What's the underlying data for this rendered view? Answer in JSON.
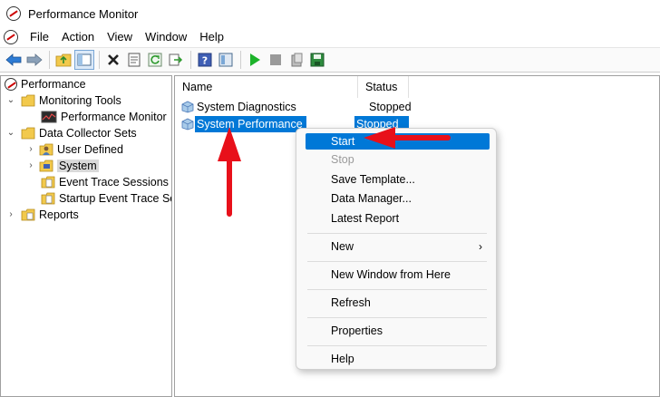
{
  "window": {
    "title": "Performance Monitor"
  },
  "menu": {
    "items": [
      "File",
      "Action",
      "View",
      "Window",
      "Help"
    ]
  },
  "toolbar": {
    "icons": [
      "back-arrow-icon",
      "forward-arrow-icon",
      "up-folder-icon",
      "show-hide-tree-icon",
      "delete-icon",
      "properties-icon",
      "refresh-icon",
      "export-list-icon",
      "help-icon",
      "console-icon",
      "start-icon",
      "stop-icon",
      "new-icon",
      "save-icon"
    ]
  },
  "tree": {
    "root": "Performance",
    "monitoring_tools": "Monitoring Tools",
    "performance_monitor": "Performance Monitor",
    "data_collector_sets": "Data Collector Sets",
    "user_defined": "User Defined",
    "system": "System",
    "event_trace_sessions": "Event Trace Sessions",
    "startup_event_trace": "Startup Event Trace Sess",
    "reports": "Reports"
  },
  "list": {
    "columns": [
      "Name",
      "Status"
    ],
    "rows": [
      {
        "name": "System Diagnostics",
        "status": "Stopped"
      },
      {
        "name": "System Performance",
        "status": "Stopped"
      }
    ]
  },
  "context_menu": {
    "start": "Start",
    "stop": "Stop",
    "save_template": "Save Template...",
    "data_manager": "Data Manager...",
    "latest_report": "Latest Report",
    "new": "New",
    "submenu_arrow": "›",
    "new_window": "New Window from Here",
    "refresh": "Refresh",
    "properties": "Properties",
    "help": "Help"
  },
  "colors": {
    "selection": "#0078d7",
    "annotation": "#e8101a",
    "play": "#1db32a"
  }
}
